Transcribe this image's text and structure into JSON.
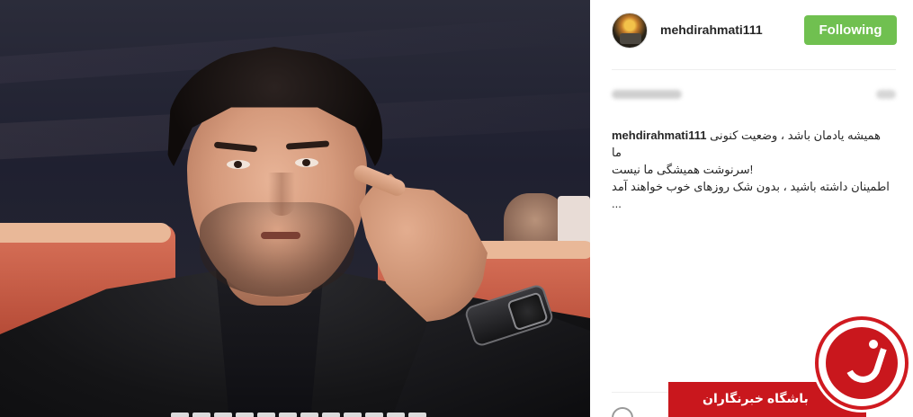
{
  "post": {
    "username": "mehdirahmati111",
    "follow_button": "Following",
    "caption_user": "mehdirahmati111",
    "caption_lines": [
      "همیشه یادمان باشد ، وضعیت کنونی",
      "ما",
      "!سرنوشت همیشگی ما نیست",
      "اطمینان داشته باشید ، بدون شک روزهای خوب خواهند آمد",
      "..."
    ]
  },
  "watermark": {
    "text": "باشگاه خبرنگاران"
  },
  "colors": {
    "follow_green": "#70c050",
    "watermark_red": "#c9171d"
  }
}
